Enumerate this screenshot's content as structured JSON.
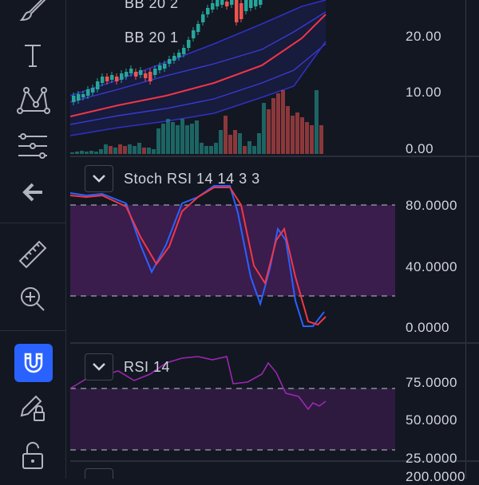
{
  "toolbar": {
    "items": [
      {
        "name": "brush-tool",
        "icon": "brush-icon"
      },
      {
        "name": "text-tool",
        "icon": "text-icon"
      },
      {
        "name": "pattern-tool",
        "icon": "xabcd-pattern-icon"
      },
      {
        "name": "fib-tool",
        "icon": "fib-retracement-icon"
      },
      {
        "name": "back-tool",
        "icon": "arrow-left-icon"
      },
      {
        "name": "measure-tool",
        "icon": "ruler-icon"
      },
      {
        "name": "zoom-tool",
        "icon": "zoom-in-icon"
      },
      {
        "name": "magnet-tool",
        "icon": "magnet-icon",
        "active": true
      },
      {
        "name": "lock-drawings-tool",
        "icon": "pencil-lock-icon"
      },
      {
        "name": "lock-all-tool",
        "icon": "unlock-icon"
      }
    ],
    "accent": "#2962ff"
  },
  "price_pane": {
    "legend_lines": [
      "BB 20 2",
      "BB 20 1"
    ],
    "ticks": [
      "20.00",
      "10.00",
      "0.00"
    ]
  },
  "stoch_pane": {
    "legend": "Stoch RSI 14 14 3 3",
    "ticks": [
      "80.0000",
      "40.0000",
      "0.0000"
    ],
    "k_color": "#2962ff",
    "d_color": "#f23645",
    "band_color": "#3a1c4d"
  },
  "rsi_pane": {
    "legend": "RSI 14",
    "ticks": [
      "75.0000",
      "50.0000",
      "25.0000"
    ],
    "line_color": "#9c27b0",
    "band_color": "#2e1a3f"
  },
  "bottom_pane": {
    "ticks": [
      "200.0000"
    ]
  },
  "colors": {
    "background": "#131722",
    "up": "#26a69a",
    "down": "#ef5350",
    "basis": "#f23645",
    "band": "#2a2e9a"
  }
}
